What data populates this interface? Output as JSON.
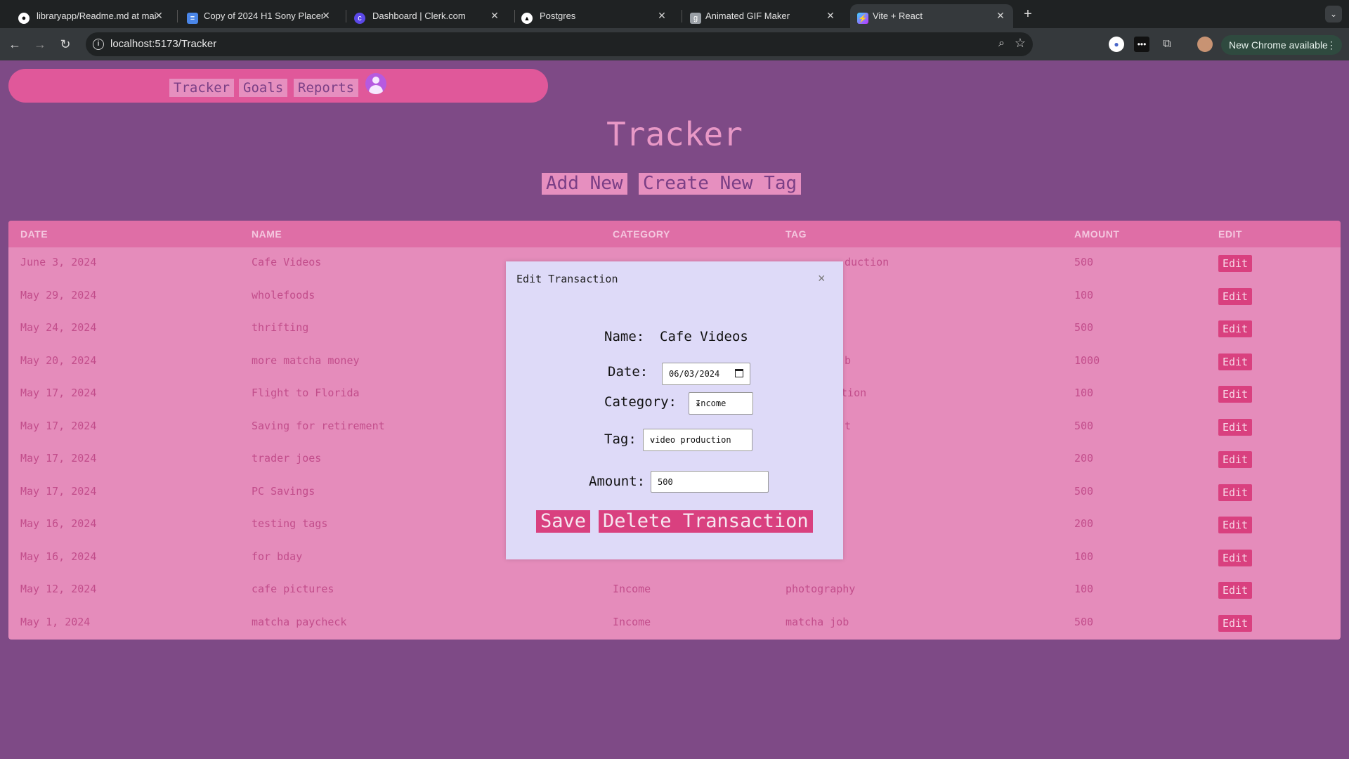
{
  "browser": {
    "tabs": [
      {
        "title": "libraryapp/Readme.md at mai",
        "icon": "github-icon",
        "active": false
      },
      {
        "title": "Copy of 2024 H1 Sony Placem",
        "icon": "google-docs-icon",
        "active": false
      },
      {
        "title": "Dashboard | Clerk.com",
        "icon": "clerk-icon",
        "active": false
      },
      {
        "title": "Postgres",
        "icon": "vercel-icon",
        "active": false
      },
      {
        "title": "Animated GIF Maker",
        "icon": "ezgif-icon",
        "active": false
      },
      {
        "title": "Vite + React",
        "icon": "vite-icon",
        "active": true
      }
    ],
    "url": "localhost:5173/Tracker",
    "update_label": "New Chrome available"
  },
  "nav": {
    "links": [
      "Tracker",
      "Goals",
      "Reports"
    ]
  },
  "page": {
    "title": "Tracker",
    "add_new_label": "Add New",
    "create_tag_label": "Create New Tag"
  },
  "table": {
    "headers": [
      "DATE",
      "NAME",
      "CATEGORY",
      "TAG",
      "AMOUNT",
      "EDIT"
    ],
    "edit_label": "Edit",
    "rows": [
      {
        "date": "June 3, 2024",
        "name": "Cafe Videos",
        "category": "",
        "tag": "duction",
        "amount": "500"
      },
      {
        "date": "May 29, 2024",
        "name": "wholefoods",
        "category": "",
        "tag": "",
        "amount": "100"
      },
      {
        "date": "May 24, 2024",
        "name": "thrifting",
        "category": "",
        "tag": "",
        "amount": "500"
      },
      {
        "date": "May 20, 2024",
        "name": "more matcha money",
        "category": "",
        "tag": "b",
        "amount": "1000"
      },
      {
        "date": "May 17, 2024",
        "name": "Flight to Florida",
        "category": "",
        "tag": "ation",
        "amount": "100"
      },
      {
        "date": "May 17, 2024",
        "name": "Saving for retirement",
        "category": "",
        "tag": "t",
        "amount": "500"
      },
      {
        "date": "May 17, 2024",
        "name": "trader joes",
        "category": "",
        "tag": "",
        "amount": "200"
      },
      {
        "date": "May 17, 2024",
        "name": "PC Savings",
        "category": "",
        "tag": "",
        "amount": "500"
      },
      {
        "date": "May 16, 2024",
        "name": "testing tags",
        "category": "",
        "tag": "",
        "amount": "200"
      },
      {
        "date": "May 16, 2024",
        "name": "for bday",
        "category": "",
        "tag": "",
        "amount": "100"
      },
      {
        "date": "May 12, 2024",
        "name": "cafe pictures",
        "category": "Income",
        "tag": "photography",
        "amount": "100"
      },
      {
        "date": "May 1, 2024",
        "name": "matcha paycheck",
        "category": "Income",
        "tag": "matcha job",
        "amount": "500"
      }
    ]
  },
  "modal": {
    "title": "Edit Transaction",
    "close_glyph": "×",
    "name_label": "Name:",
    "name_value": "Cafe Videos",
    "date_label": "Date:",
    "date_value": "06/03/2024",
    "category_label": "Category:",
    "category_value": "Income",
    "tag_label": "Tag:",
    "tag_value": "video production",
    "amount_label": "Amount:",
    "amount_value": "500",
    "save_label": "Save",
    "delete_label": "Delete Transaction"
  },
  "colors": {
    "page_bg": "#7e4a86",
    "nav_bg": "#e0589a",
    "table_bg": "#e58cbb",
    "header_bg": "#df6ea6",
    "accent": "#d9407f",
    "modal_bg": "#dedaf8"
  }
}
